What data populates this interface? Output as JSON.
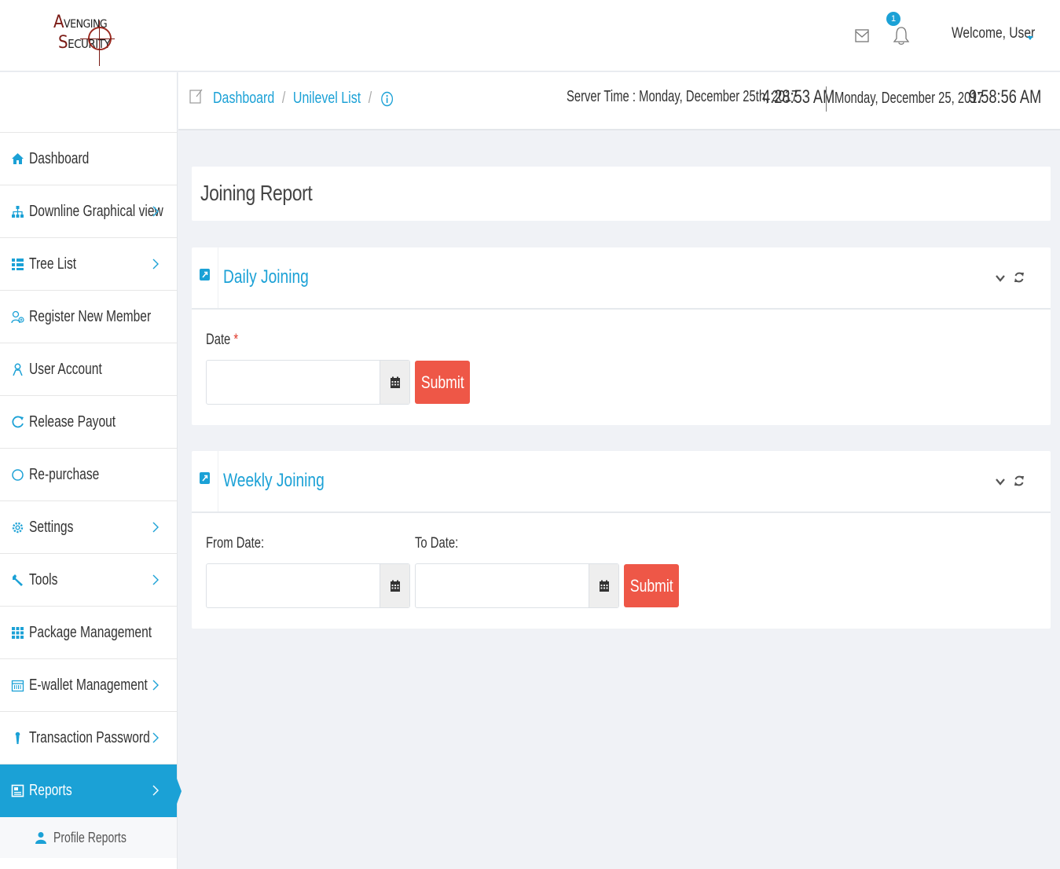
{
  "header": {
    "logo_line1": "VENGING",
    "logo_line2": "ECURITY",
    "logo_initial1": "A",
    "logo_initial2": "S",
    "notification_count": "1",
    "welcome_text": "Welcome, User",
    "icons": [
      "mail-icon",
      "bell-icon",
      "caret-down-icon"
    ]
  },
  "breadcrumb": {
    "items": [
      "Dashboard",
      "Unilevel List"
    ],
    "separator": "/",
    "server_time_label": "Server Time : Monday, December 25th, 2017",
    "server_time": "4:28:53 AM",
    "local_date": "Monday, December 25, 2017",
    "local_time": "9:58:56 AM"
  },
  "sidebar": {
    "items": [
      {
        "label": "Dashboard",
        "icon": "home-icon",
        "has_children": false
      },
      {
        "label": "Downline Graphical view",
        "icon": "sitemap-icon",
        "has_children": true
      },
      {
        "label": "Tree List",
        "icon": "list-icon",
        "has_children": true
      },
      {
        "label": "Register New Member",
        "icon": "user-plus-icon",
        "has_children": false
      },
      {
        "label": "User Account",
        "icon": "user-icon",
        "has_children": false
      },
      {
        "label": "Release Payout",
        "icon": "refresh-icon",
        "has_children": false
      },
      {
        "label": "Re-purchase",
        "icon": "circle-icon",
        "has_children": false
      },
      {
        "label": "Settings",
        "icon": "gear-icon",
        "has_children": true
      },
      {
        "label": "Tools",
        "icon": "wrench-icon",
        "has_children": true
      },
      {
        "label": "Package Management",
        "icon": "grid-icon",
        "has_children": false
      },
      {
        "label": "E-wallet Management",
        "icon": "calendar-icon",
        "has_children": true
      },
      {
        "label": "Transaction Password",
        "icon": "key-icon",
        "has_children": true
      },
      {
        "label": "Reports",
        "icon": "report-icon",
        "has_children": true,
        "active": true
      }
    ],
    "sub_items": [
      {
        "label": "Profile Reports",
        "icon": "user-icon"
      }
    ]
  },
  "main": {
    "page_title": "Joining Report",
    "daily": {
      "title": "Daily Joining",
      "date_label": "Date",
      "required_mark": "*",
      "date_value": "",
      "submit_label": "Submit"
    },
    "weekly": {
      "title": "Weekly Joining",
      "from_label": "From Date:",
      "to_label": "To Date:",
      "from_value": "",
      "to_value": "",
      "submit_label": "Submit"
    }
  },
  "colors": {
    "accent": "#1ba1d6",
    "submit": "#ee5747",
    "background": "#f0f2f6"
  }
}
